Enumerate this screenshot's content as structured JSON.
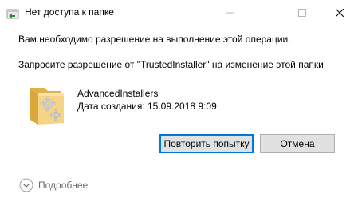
{
  "window": {
    "title": "Нет доступа к папке",
    "title_icon": "folder-access-icon",
    "minimize_icon": "minimize-icon",
    "maximize_icon": "maximize-icon",
    "close_icon": "close-icon"
  },
  "message": {
    "line1": "Вам необходимо разрешение на выполнение этой операции.",
    "line2": "Запросите разрешение от \"TrustedInstaller\" на изменение этой папки"
  },
  "item": {
    "icon": "folder-icon",
    "name": "AdvancedInstallers",
    "date": "Дата создания: 15.09.2018 9:09"
  },
  "buttons": {
    "retry": "Повторить попытку",
    "cancel": "Отмена"
  },
  "footer": {
    "more_icon": "chevron-down-icon",
    "more_label": "Подробнее"
  },
  "colors": {
    "accent": "#0078d7",
    "button_bg": "#e1e1e1",
    "footer_text": "#6d6d6d"
  }
}
